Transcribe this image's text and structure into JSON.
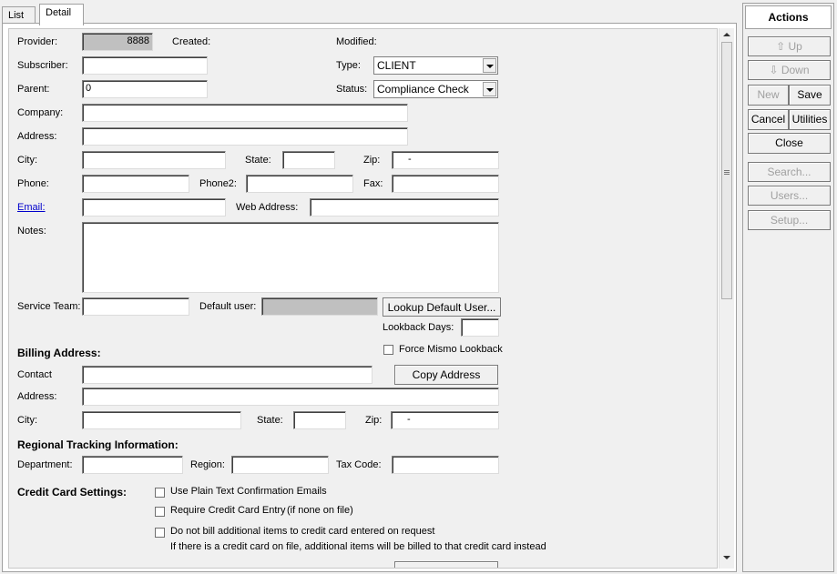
{
  "tabs": [
    "List",
    "Detail"
  ],
  "fields": {
    "provider_label": "Provider:",
    "provider_value": "8888",
    "created_label": "Created:",
    "modified_label": "Modified:",
    "subscriber_label": "Subscriber:",
    "subscriber_value": "",
    "type_label": "Type:",
    "type_value": "CLIENT",
    "parent_label": "Parent:",
    "parent_value": "0",
    "status_label": "Status:",
    "status_value": "Compliance Check",
    "company_label": "Company:",
    "company_value": "",
    "address_label": "Address:",
    "address_value": "",
    "city_label": "City:",
    "city_value": "",
    "state_label": "State:",
    "state_value": "",
    "zip_label": "Zip:",
    "zip_value": "-",
    "phone_label": "Phone:",
    "phone_value": "",
    "phone2_label": "Phone2:",
    "phone2_value": "",
    "fax_label": "Fax:",
    "fax_value": "",
    "email_label": "Email:",
    "email_value": "",
    "web_label": "Web Address:",
    "web_value": "",
    "notes_label": "Notes:",
    "notes_value": "",
    "service_team_label": "Service Team:",
    "service_team_value": "",
    "default_user_label": "Default user:",
    "default_user_value": "",
    "lookup_default_user_button": "Lookup Default User...",
    "lookback_days_label": "Lookback Days:",
    "lookback_days_value": "",
    "force_mismo_label": "Force Mismo Lookback"
  },
  "billing": {
    "heading": "Billing Address:",
    "contact_label": "Contact",
    "contact_value": "",
    "copy_address_button": "Copy Address",
    "address_label": "Address:",
    "address_value": "",
    "city_label": "City:",
    "city_value": "",
    "state_label": "State:",
    "state_value": "",
    "zip_label": "Zip:",
    "zip_value": "-"
  },
  "regional": {
    "heading": "Regional Tracking Information:",
    "department_label": "Department:",
    "department_value": "",
    "region_label": "Region:",
    "region_value": "",
    "tax_code_label": "Tax Code:",
    "tax_code_value": ""
  },
  "credit_card": {
    "heading": "Credit Card Settings:",
    "option1": "Use Plain Text Confirmation Emails",
    "option2": "Require Credit Card Entry",
    "option2_note": "(if none on file)",
    "option3": "Do not bill additional items to credit card entered on request",
    "option3_note": "If there is a credit card on file, additional items will be billed to that credit card instead"
  },
  "actions": {
    "title": "Actions",
    "up": "Up",
    "down": "Down",
    "new": "New",
    "save": "Save",
    "cancel": "Cancel",
    "utilities": "Utilities",
    "close": "Close",
    "search": "Search...",
    "users": "Users...",
    "setup": "Setup..."
  }
}
